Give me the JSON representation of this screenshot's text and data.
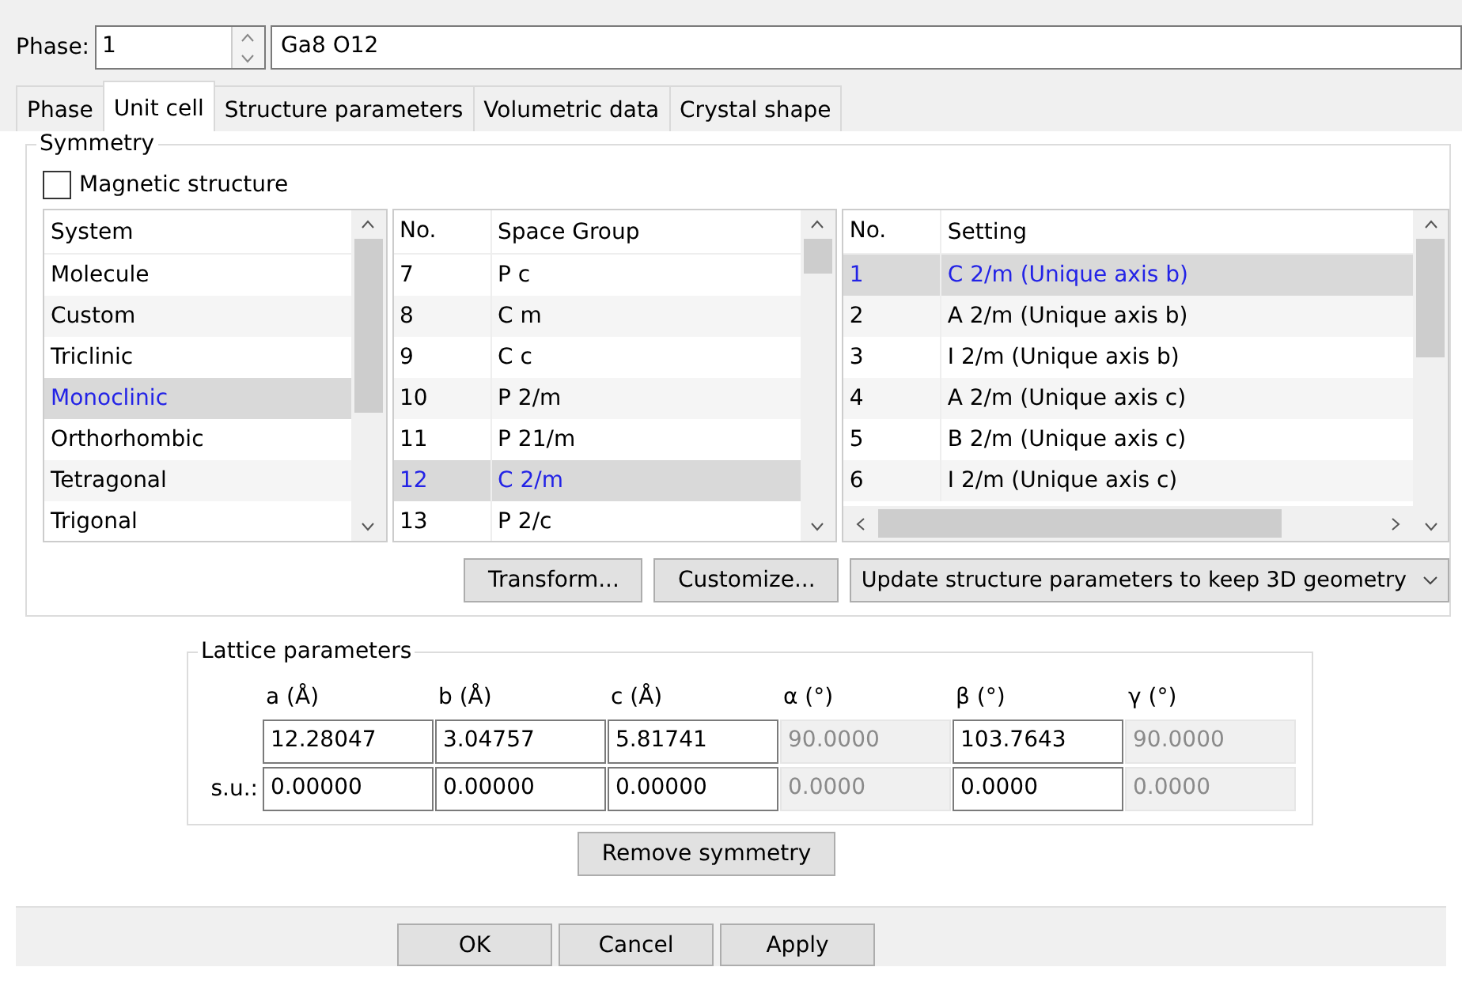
{
  "phase": {
    "label": "Phase:",
    "number": "1",
    "formula": "Ga8 O12"
  },
  "tabs": [
    {
      "label": "Phase",
      "selected": false
    },
    {
      "label": "Unit cell",
      "selected": true
    },
    {
      "label": "Structure parameters",
      "selected": false
    },
    {
      "label": "Volumetric data",
      "selected": false
    },
    {
      "label": "Crystal shape",
      "selected": false
    }
  ],
  "symmetry": {
    "title": "Symmetry",
    "magnetic": {
      "label": "Magnetic structure",
      "checked": false
    },
    "system_list": {
      "header": "System",
      "rows": [
        {
          "name": "Molecule",
          "selected": false
        },
        {
          "name": "Custom",
          "selected": false
        },
        {
          "name": "Triclinic",
          "selected": false
        },
        {
          "name": "Monoclinic",
          "selected": true
        },
        {
          "name": "Orthorhombic",
          "selected": false
        },
        {
          "name": "Tetragonal",
          "selected": false
        },
        {
          "name": "Trigonal",
          "selected": false
        }
      ]
    },
    "space_group_list": {
      "headers": [
        "No.",
        "Space Group"
      ],
      "rows": [
        {
          "no": "7",
          "name": "P c",
          "selected": false
        },
        {
          "no": "8",
          "name": "C m",
          "selected": false
        },
        {
          "no": "9",
          "name": "C c",
          "selected": false
        },
        {
          "no": "10",
          "name": "P 2/m",
          "selected": false
        },
        {
          "no": "11",
          "name": "P 21/m",
          "selected": false
        },
        {
          "no": "12",
          "name": "C 2/m",
          "selected": true
        },
        {
          "no": "13",
          "name": "P 2/c",
          "selected": false
        }
      ]
    },
    "setting_list": {
      "headers": [
        "No.",
        "Setting"
      ],
      "rows": [
        {
          "no": "1",
          "name": "C 2/m (Unique axis b)",
          "selected": true
        },
        {
          "no": "2",
          "name": "A 2/m (Unique axis b)",
          "selected": false
        },
        {
          "no": "3",
          "name": "I 2/m (Unique axis b)",
          "selected": false
        },
        {
          "no": "4",
          "name": "A 2/m (Unique axis c)",
          "selected": false
        },
        {
          "no": "5",
          "name": "B 2/m (Unique axis c)",
          "selected": false
        },
        {
          "no": "6",
          "name": "I 2/m (Unique axis c)",
          "selected": false
        }
      ]
    },
    "buttons": [
      "Transform...",
      "Customize..."
    ],
    "update_mode": "Update structure parameters to keep 3D geometry"
  },
  "lattice": {
    "title": "Lattice parameters",
    "columns": [
      "a (Å)",
      "b (Å)",
      "c (Å)",
      "α (°)",
      "β (°)",
      "γ (°)"
    ],
    "values": [
      {
        "value": "12.28047",
        "disabled": false
      },
      {
        "value": "3.04757",
        "disabled": false
      },
      {
        "value": "5.81741",
        "disabled": false
      },
      {
        "value": "90.0000",
        "disabled": true
      },
      {
        "value": "103.7643",
        "disabled": false
      },
      {
        "value": "90.0000",
        "disabled": true
      }
    ],
    "su_label": "s.u.:",
    "su": [
      {
        "value": "0.00000",
        "disabled": false
      },
      {
        "value": "0.00000",
        "disabled": false
      },
      {
        "value": "0.00000",
        "disabled": false
      },
      {
        "value": "0.0000",
        "disabled": true
      },
      {
        "value": "0.0000",
        "disabled": false
      },
      {
        "value": "0.0000",
        "disabled": true
      }
    ]
  },
  "remove_button": "Remove symmetry",
  "dialog_buttons": [
    "OK",
    "Cancel",
    "Apply"
  ]
}
